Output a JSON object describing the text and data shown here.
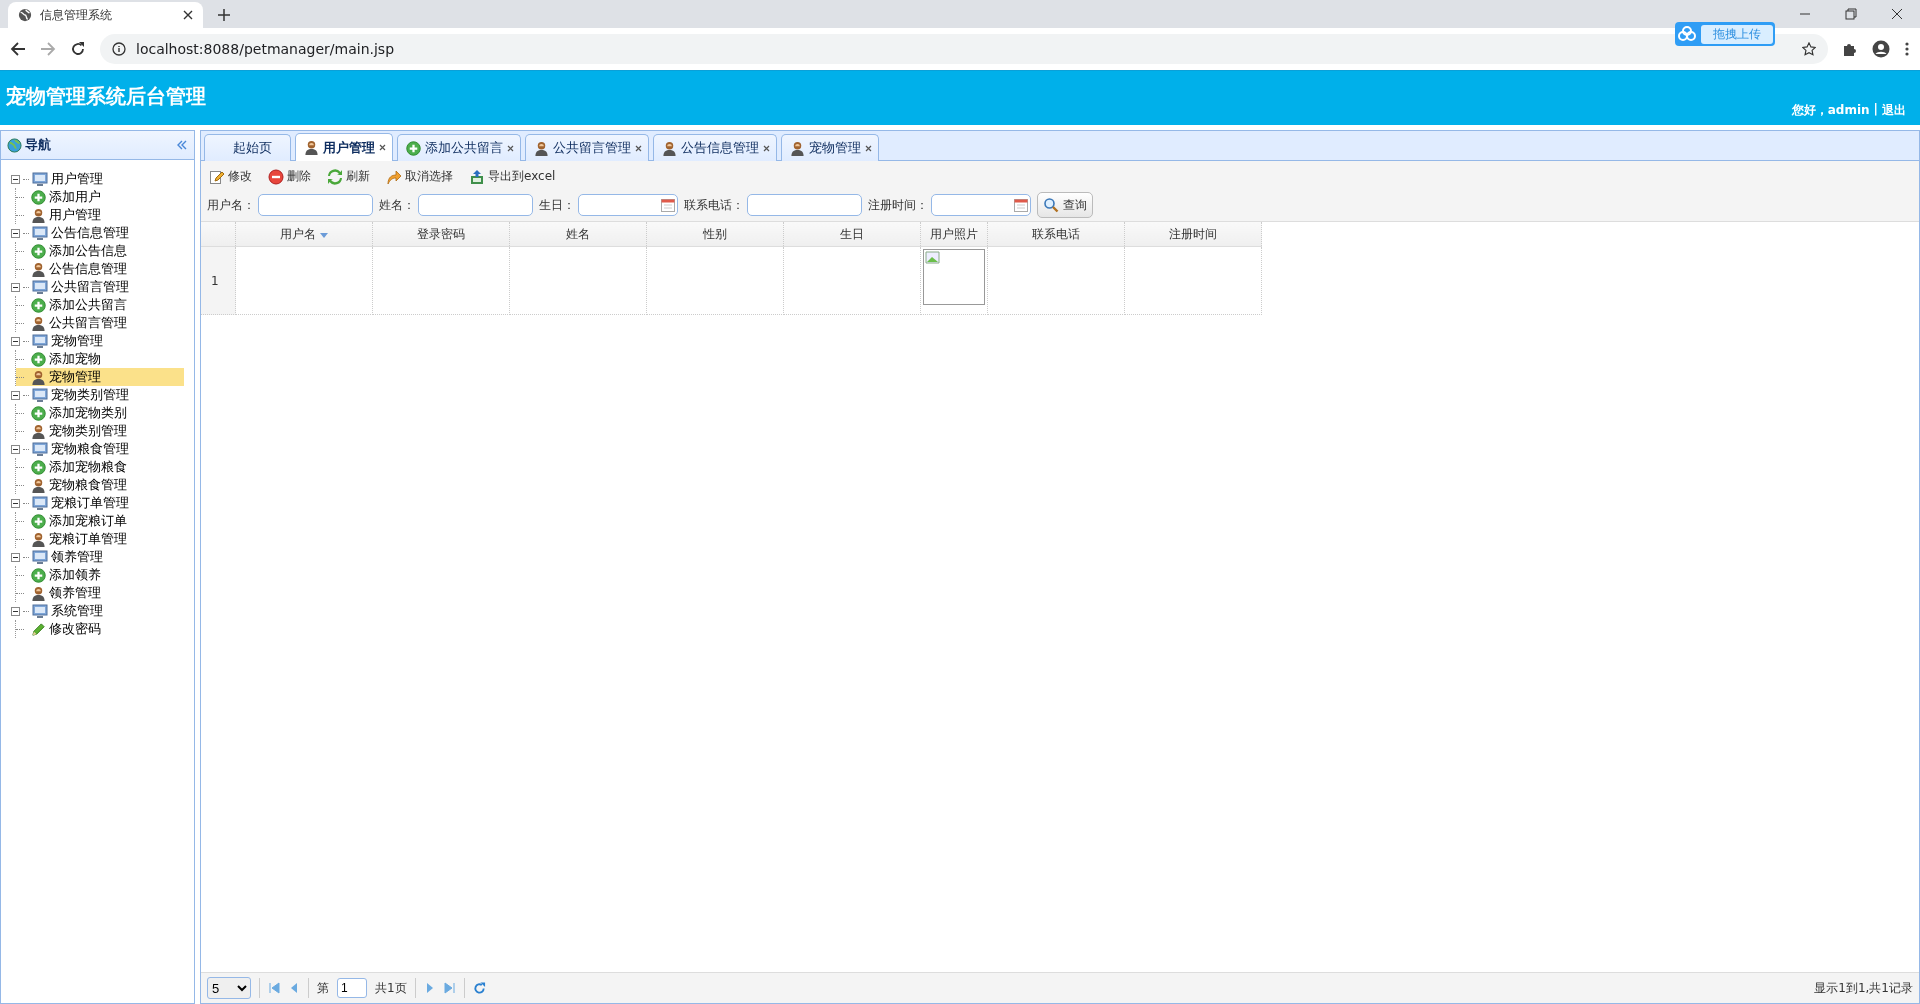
{
  "browser": {
    "tab_title": "信息管理系统",
    "url": "localhost:8088/petmanager/main.jsp",
    "extension_label": "拖拽上传"
  },
  "header": {
    "title": "宠物管理系统后台管理",
    "greeting": "您好，admin",
    "separator": "|",
    "logout": "退出"
  },
  "nav": {
    "title": "导航",
    "groups": [
      {
        "label": "用户管理",
        "expanded": true,
        "children": [
          {
            "label": "添加用户",
            "kind": "add",
            "selected": false
          },
          {
            "label": "用户管理",
            "kind": "manage",
            "selected": false
          }
        ]
      },
      {
        "label": "公告信息管理",
        "expanded": true,
        "children": [
          {
            "label": "添加公告信息",
            "kind": "add",
            "selected": false
          },
          {
            "label": "公告信息管理",
            "kind": "manage",
            "selected": false
          }
        ]
      },
      {
        "label": "公共留言管理",
        "expanded": true,
        "children": [
          {
            "label": "添加公共留言",
            "kind": "add",
            "selected": false
          },
          {
            "label": "公共留言管理",
            "kind": "manage",
            "selected": false
          }
        ]
      },
      {
        "label": "宠物管理",
        "expanded": true,
        "children": [
          {
            "label": "添加宠物",
            "kind": "add",
            "selected": false
          },
          {
            "label": "宠物管理",
            "kind": "manage",
            "selected": true
          }
        ]
      },
      {
        "label": "宠物类别管理",
        "expanded": true,
        "children": [
          {
            "label": "添加宠物类别",
            "kind": "add",
            "selected": false
          },
          {
            "label": "宠物类别管理",
            "kind": "manage",
            "selected": false
          }
        ]
      },
      {
        "label": "宠物粮食管理",
        "expanded": true,
        "children": [
          {
            "label": "添加宠物粮食",
            "kind": "add",
            "selected": false
          },
          {
            "label": "宠物粮食管理",
            "kind": "manage",
            "selected": false
          }
        ]
      },
      {
        "label": "宠粮订单管理",
        "expanded": true,
        "children": [
          {
            "label": "添加宠粮订单",
            "kind": "add",
            "selected": false
          },
          {
            "label": "宠粮订单管理",
            "kind": "manage",
            "selected": false
          }
        ]
      },
      {
        "label": "领养管理",
        "expanded": true,
        "children": [
          {
            "label": "添加领养",
            "kind": "add",
            "selected": false
          },
          {
            "label": "领养管理",
            "kind": "manage",
            "selected": false
          }
        ]
      },
      {
        "label": "系统管理",
        "expanded": true,
        "children": [
          {
            "label": "修改密码",
            "kind": "edit",
            "selected": false
          }
        ]
      }
    ]
  },
  "tabs": [
    {
      "label": "起始页",
      "kind": "plain",
      "closable": false,
      "selected": false
    },
    {
      "label": "用户管理",
      "kind": "manage",
      "closable": true,
      "selected": true
    },
    {
      "label": "添加公共留言",
      "kind": "add",
      "closable": true,
      "selected": false
    },
    {
      "label": "公共留言管理",
      "kind": "manage",
      "closable": true,
      "selected": false
    },
    {
      "label": "公告信息管理",
      "kind": "manage",
      "closable": true,
      "selected": false
    },
    {
      "label": "宠物管理",
      "kind": "manage",
      "closable": true,
      "selected": false
    }
  ],
  "toolbar": [
    {
      "label": "修改",
      "kind": "edit"
    },
    {
      "label": "删除",
      "kind": "delete"
    },
    {
      "label": "刷新",
      "kind": "refresh"
    },
    {
      "label": "取消选择",
      "kind": "undo"
    },
    {
      "label": "导出到excel",
      "kind": "export"
    }
  ],
  "search": {
    "fields": [
      {
        "label": "用户名：",
        "kind": "text"
      },
      {
        "label": "姓名：",
        "kind": "text"
      },
      {
        "label": "生日：",
        "kind": "date"
      },
      {
        "label": "联系电话：",
        "kind": "text"
      },
      {
        "label": "注册时间：",
        "kind": "date"
      }
    ],
    "button": "查询"
  },
  "table": {
    "columns": [
      {
        "label": "用户名",
        "kind": "text",
        "sorted": true
      },
      {
        "label": "登录密码",
        "kind": "text",
        "sorted": false
      },
      {
        "label": "姓名",
        "kind": "text",
        "sorted": false
      },
      {
        "label": "性别",
        "kind": "text",
        "sorted": false
      },
      {
        "label": "生日",
        "kind": "text",
        "sorted": false
      },
      {
        "label": "用户照片",
        "kind": "image",
        "sorted": false
      },
      {
        "label": "联系电话",
        "kind": "text",
        "sorted": false
      },
      {
        "label": "注册时间",
        "kind": "text",
        "sorted": false
      }
    ],
    "rows": [
      {
        "number": "1"
      }
    ]
  },
  "pager": {
    "page_size": "5",
    "page_prefix": "第",
    "page": "1",
    "page_suffix": "共1页",
    "summary": "显示1到1,共1记录"
  }
}
